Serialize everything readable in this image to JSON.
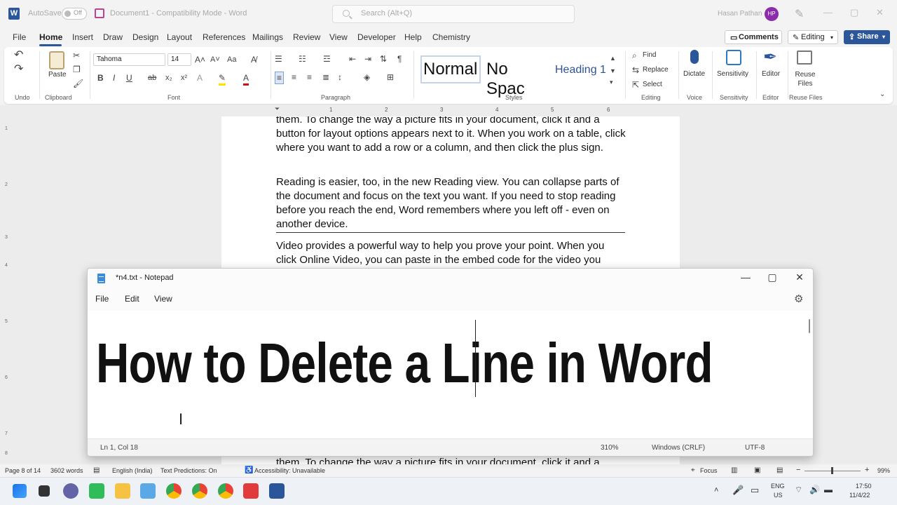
{
  "word": {
    "titlebar": {
      "autosave_label": "AutoSave",
      "autosave_state": "Off",
      "doc_title": "Document1  -  Compatibility Mode  -  Word",
      "search_placeholder": "Search (Alt+Q)",
      "user_name": "Hasan Pathan",
      "user_initials": "HP"
    },
    "menu": [
      "File",
      "Home",
      "Insert",
      "Draw",
      "Design",
      "Layout",
      "References",
      "Mailings",
      "Review",
      "View",
      "Developer",
      "Help",
      "Chemistry"
    ],
    "actions": {
      "comments": "Comments",
      "editing": "Editing",
      "share": "Share"
    },
    "ribbon": {
      "groups": {
        "undo": "Undo",
        "clipboard": "Clipboard",
        "font": "Font",
        "paragraph": "Paragraph",
        "styles": "Styles",
        "editing": "Editing",
        "voice": "Voice",
        "sensitivity": "Sensitivity",
        "editor": "Editor",
        "reuse": "Reuse Files"
      },
      "paste": "Paste",
      "font_name": "Tahoma",
      "font_size": "14",
      "styles": [
        "Normal",
        "No Spac",
        "Heading 1"
      ],
      "find": "Find",
      "replace": "Replace",
      "select": "Select",
      "dictate": "Dictate",
      "sensitivity": "Sensitivity",
      "editor": "Editor",
      "reuse_files": "Reuse Files"
    },
    "ruler_numbers": [
      "1",
      "2",
      "3",
      "4",
      "5",
      "6"
    ],
    "vruler_numbers": [
      "1",
      "2",
      "3",
      "4",
      "5",
      "6",
      "7",
      "8"
    ],
    "document": {
      "para1": "them. To change the way a picture fits in your document, click it and a button for layout options appears next to it. When you work on a table, click where you want to add a row or a column, and then click the plus sign.",
      "para2": "Reading is easier, too, in the new Reading view. You can collapse parts of the document and focus on the text you want. If you need to stop reading before you reach the end, Word remembers where you left off - even on another device.",
      "para3": "Video provides a powerful way to help you prove your point. When you click Online Video, you can paste in the embed code for the video you",
      "para4": "them. To change the way a picture fits in your document, click it and a"
    },
    "statusbar": {
      "page": "Page 8 of 14",
      "words": "3602 words",
      "language": "English (India)",
      "predictions": "Text Predictions: On",
      "accessibility": "Accessibility: Unavailable",
      "focus": "Focus",
      "zoom": "99%"
    }
  },
  "notepad": {
    "title": "*n4.txt - Notepad",
    "menu": [
      "File",
      "Edit",
      "View"
    ],
    "content": "How to Delete a Line in Word",
    "status": {
      "position": "Ln 1, Col 18",
      "zoom": "310%",
      "line_ending": "Windows (CRLF)",
      "encoding": "UTF-8"
    }
  },
  "taskbar": {
    "lang_top": "ENG",
    "lang_bottom": "US",
    "time": "17:50",
    "date": "11/4/22"
  },
  "colors": {
    "word_blue": "#2b579a",
    "avatar": "#8b2cab",
    "heading_style": "#2f5496"
  }
}
